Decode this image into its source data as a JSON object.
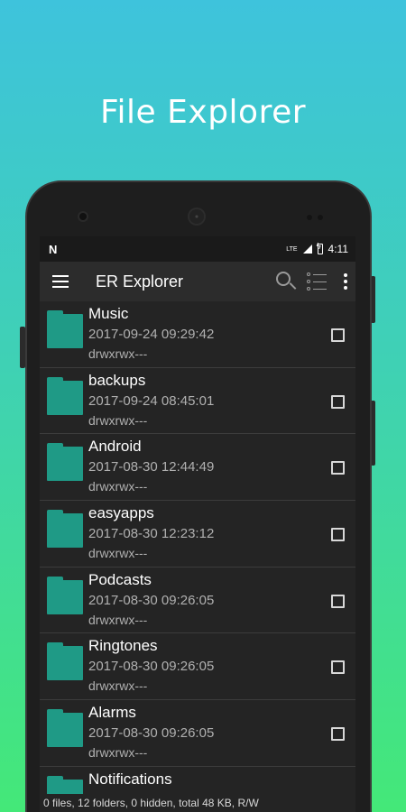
{
  "promo": {
    "title": "File Explorer"
  },
  "statusbar": {
    "left_logo": "N",
    "lte": "LTE",
    "time": "4:11"
  },
  "appbar": {
    "title": "ER Explorer"
  },
  "files": [
    {
      "name": "Music",
      "date": "2017-09-24 09:29:42",
      "perm": "drwxrwx---"
    },
    {
      "name": "backups",
      "date": "2017-09-24 08:45:01",
      "perm": "drwxrwx---"
    },
    {
      "name": "Android",
      "date": "2017-08-30 12:44:49",
      "perm": "drwxrwx---"
    },
    {
      "name": "easyapps",
      "date": "2017-08-30 12:23:12",
      "perm": "drwxrwx---"
    },
    {
      "name": "Podcasts",
      "date": "2017-08-30 09:26:05",
      "perm": "drwxrwx---"
    },
    {
      "name": "Ringtones",
      "date": "2017-08-30 09:26:05",
      "perm": "drwxrwx---"
    },
    {
      "name": "Alarms",
      "date": "2017-08-30 09:26:05",
      "perm": "drwxrwx---"
    },
    {
      "name": "Notifications",
      "date": "",
      "perm": ""
    }
  ],
  "footer": {
    "summary": "0 files, 12 folders, 0 hidden, total 48 KB, R/W"
  },
  "colors": {
    "folder": "#1f9a86",
    "background_top": "#3ec3dc",
    "background_bottom": "#44e878"
  }
}
